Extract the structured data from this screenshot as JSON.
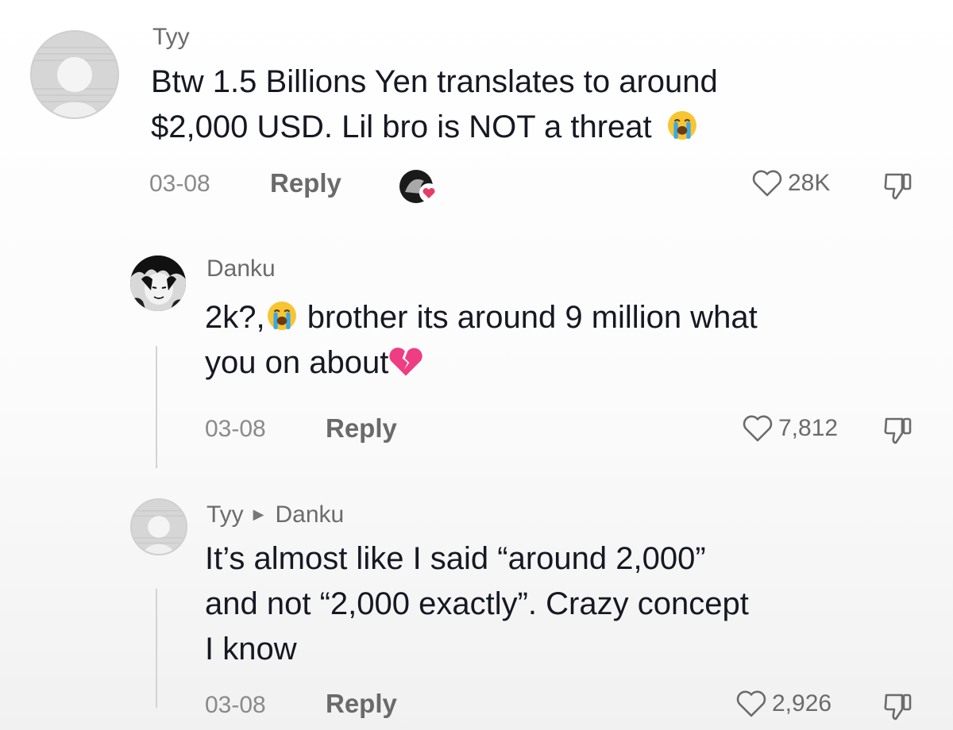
{
  "comments": [
    {
      "username": "Tyy",
      "text_line1": "Btw 1.5 Billions Yen translates to around",
      "text_line2": "$2,000 USD. Lil bro is NOT a threat",
      "date": "03-08",
      "reply_label": "Reply",
      "likes": "28K"
    },
    {
      "username": "Danku",
      "text_part1": "2k?,",
      "text_part2": " brother its around 9 million what",
      "text_line2": "you on about",
      "date": "03-08",
      "reply_label": "Reply",
      "likes": "7,812"
    },
    {
      "username": "Tyy",
      "reply_to": "Danku",
      "text_line1": "It’s almost like I said “around 2,000”",
      "text_line2": "and not “2,000 exactly”. Crazy concept",
      "text_line3": "I know",
      "date": "03-08",
      "reply_label": "Reply",
      "likes": "2,926"
    }
  ],
  "icons": {
    "like": "heart-outline-icon",
    "dislike": "thumbs-down-icon",
    "creator_liked": "creator-liked-badge-icon",
    "crying_emoji": "loudly-crying-face-emoji",
    "broken_heart_emoji": "broken-heart-emoji"
  },
  "colors": {
    "text_primary": "#161823",
    "text_secondary": "#8a8a8a",
    "broken_heart": "#ee3d82",
    "emoji_yellow": "#f7c531",
    "emoji_tears": "#3aa8e8"
  }
}
